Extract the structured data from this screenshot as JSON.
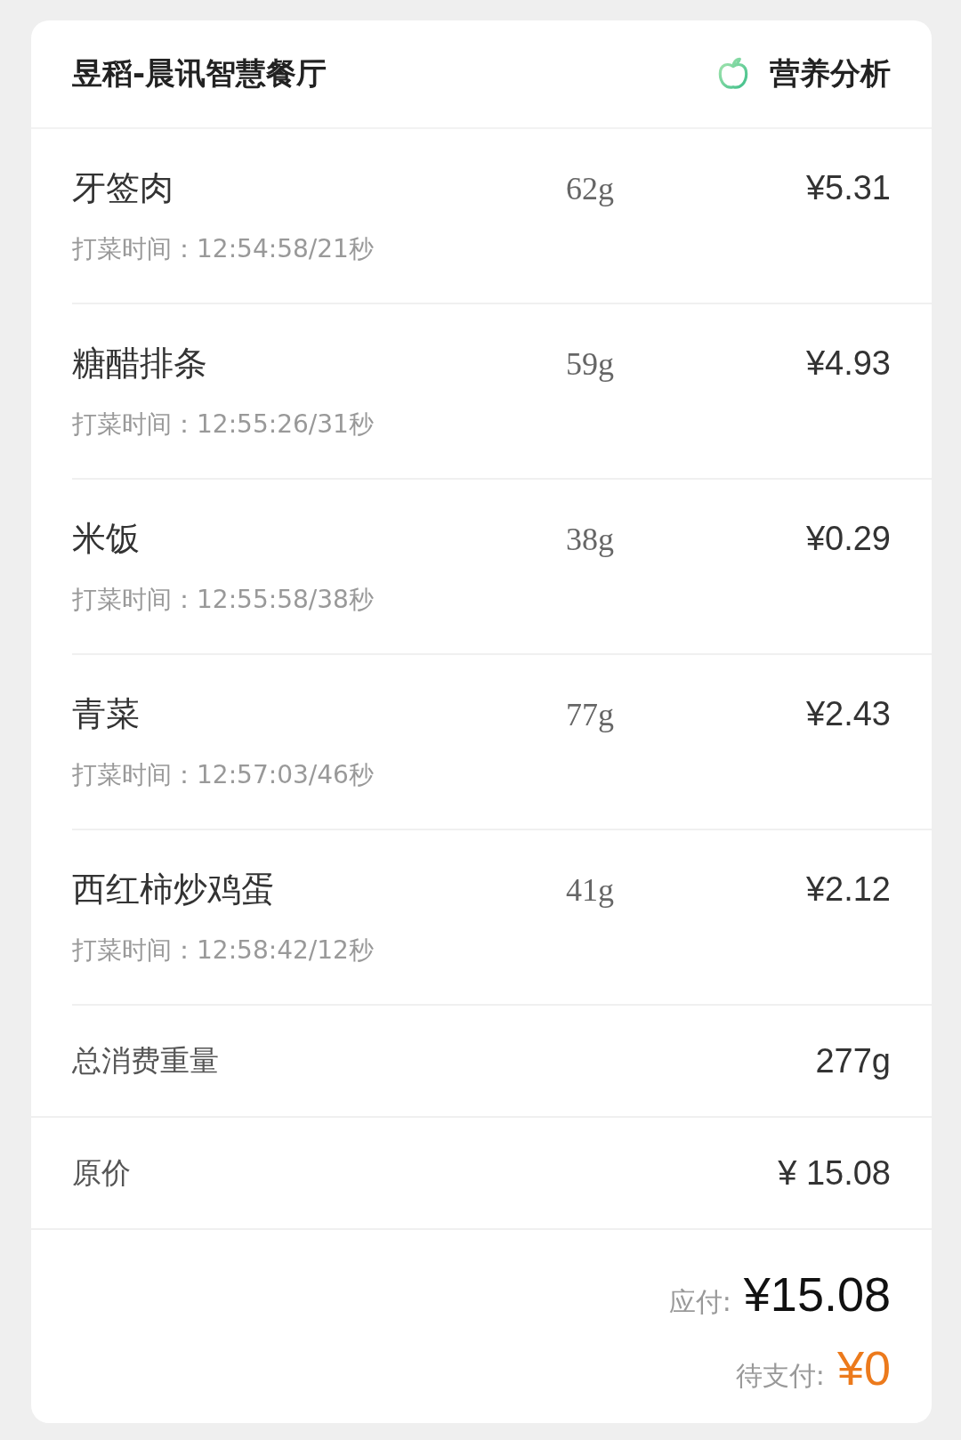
{
  "header": {
    "title": "昱稻-晨讯智慧餐厅",
    "nutrition_link": "营养分析"
  },
  "items": [
    {
      "name": "牙签肉",
      "weight": "62g",
      "price": "¥5.31",
      "time": "打菜时间：12:54:58/21秒"
    },
    {
      "name": "糖醋排条",
      "weight": "59g",
      "price": "¥4.93",
      "time": "打菜时间：12:55:26/31秒"
    },
    {
      "name": "米饭",
      "weight": "38g",
      "price": "¥0.29",
      "time": "打菜时间：12:55:58/38秒"
    },
    {
      "name": "青菜",
      "weight": "77g",
      "price": "¥2.43",
      "time": "打菜时间：12:57:03/46秒"
    },
    {
      "name": "西红柿炒鸡蛋",
      "weight": "41g",
      "price": "¥2.12",
      "time": "打菜时间：12:58:42/12秒"
    }
  ],
  "summary": [
    {
      "label": "总消费重量",
      "value": "277g"
    },
    {
      "label": "原价",
      "value": "¥ 15.08"
    }
  ],
  "payable": {
    "label": "应付:",
    "value": "¥15.08"
  },
  "pending": {
    "label": "待支付:",
    "value": "¥0"
  }
}
